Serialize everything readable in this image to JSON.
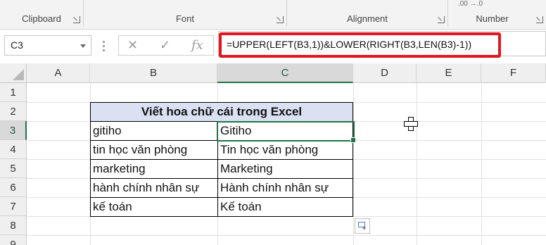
{
  "ribbon": {
    "groups": [
      {
        "label": "Clipboard"
      },
      {
        "label": "Font"
      },
      {
        "label": "Alignment"
      },
      {
        "label": "Number"
      }
    ],
    "number_snippet": ".00  →.0"
  },
  "formula_bar": {
    "name_box": "C3",
    "cancel": "✕",
    "enter": "✓",
    "fx": "fx",
    "formula": "=UPPER(LEFT(B3,1))&LOWER(RIGHT(B3,LEN(B3)-1))"
  },
  "columns": [
    "A",
    "B",
    "C",
    "D",
    "E",
    "F"
  ],
  "rows": [
    "1",
    "2",
    "3",
    "4",
    "5",
    "6",
    "7",
    "8",
    "9"
  ],
  "table": {
    "title": "Viết hoa chữ cái trong Excel",
    "rows": [
      {
        "b": "gitiho",
        "c": "Gitiho"
      },
      {
        "b": "tin học văn phòng",
        "c": "Tin học văn phòng"
      },
      {
        "b": "marketing",
        "c": "Marketing"
      },
      {
        "b": "hành chính nhân sự",
        "c": "Hành chính nhân sự"
      },
      {
        "b": "kế toán",
        "c": "Kế toán"
      }
    ]
  },
  "colors": {
    "accent": "#217346",
    "highlight": "#e0171f",
    "title_fill": "#d9e1f2"
  }
}
